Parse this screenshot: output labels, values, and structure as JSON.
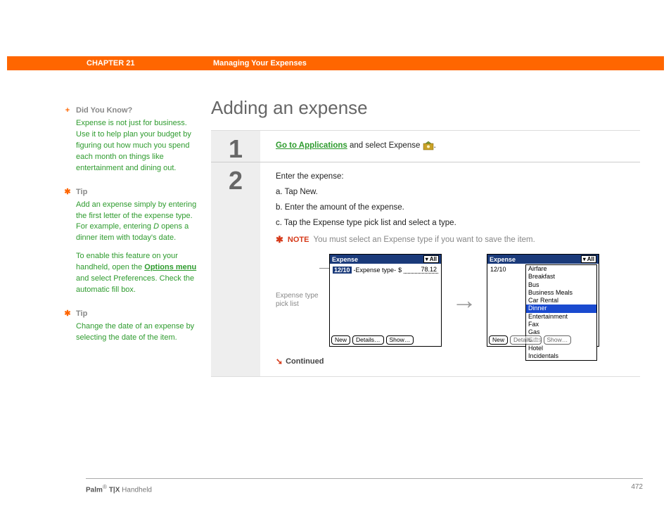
{
  "header": {
    "chapter": "CHAPTER 21",
    "title": "Managing Your Expenses"
  },
  "sidebar": {
    "didyouknow": {
      "head": "Did You Know?",
      "body": "Expense is not just for business. Use it to help plan your budget by figuring out how much you spend each month on things like entertainment and dining out."
    },
    "tip1": {
      "head": "Tip",
      "body_a": "Add an expense simply by entering the first letter of the expense type. For example, entering ",
      "body_italic": "D",
      "body_b": " opens a dinner item with today's date.",
      "body2_a": "To enable this feature on your handheld, open the ",
      "body2_link": "Options menu",
      "body2_b": " and select Preferences. Check the automatic fill box."
    },
    "tip2": {
      "head": "Tip",
      "body": "Change the date of an expense by selecting the date of the item."
    }
  },
  "main": {
    "title": "Adding an expense",
    "step1": {
      "num": "1",
      "link": "Go to Applications",
      "text_a": " and select Expense ",
      "text_b": "."
    },
    "step2": {
      "num": "2",
      "intro": "Enter the expense:",
      "a": "a.  Tap New.",
      "b": "b.  Enter the amount of the expense.",
      "c": "c.  Tap the Expense type pick list and select a type.",
      "note_label": "NOTE",
      "note_text": "You must select an Expense type if you want to save the item.",
      "picklist_label": "Expense type pick list",
      "continued": "Continued"
    },
    "screens": {
      "header_title": "Expense",
      "header_dd": "All",
      "date": "12/10",
      "expense_type_placeholder": "-Expense type-",
      "currency": "$",
      "amount": "78.12",
      "btn_new": "New",
      "btn_details": "Details…",
      "btn_show": "Show…",
      "types": [
        "Airfare",
        "Breakfast",
        "Bus",
        "Business Meals",
        "Car Rental",
        "Dinner",
        "Entertainment",
        "Fax",
        "Gas",
        "Gifts",
        "Hotel",
        "Incidentals"
      ],
      "selected_index": 5
    }
  },
  "footer": {
    "brand_a": "Palm",
    "brand_b": " T|X",
    "brand_c": " Handheld",
    "page": "472"
  }
}
